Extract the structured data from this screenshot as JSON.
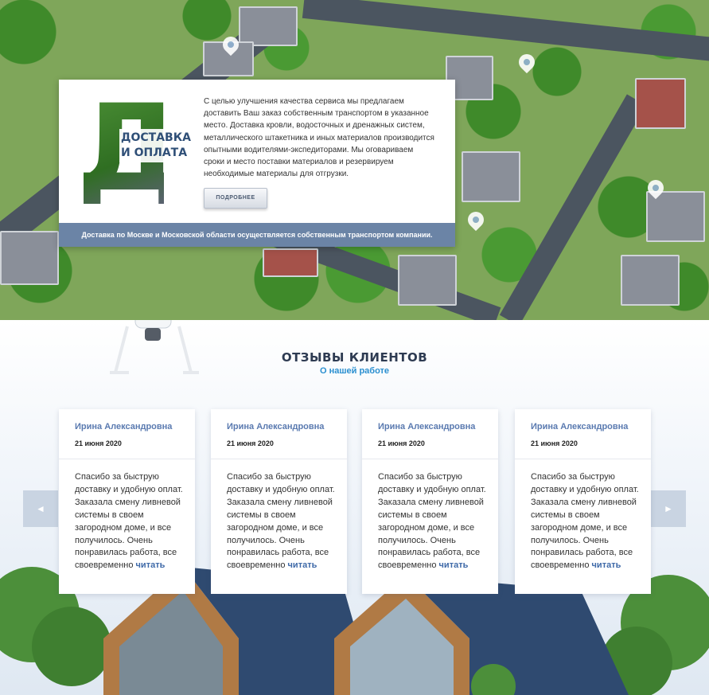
{
  "delivery": {
    "big_letter": "Д",
    "title_line1": "ДОСТАВКА",
    "title_line2": "И ОПЛАТА",
    "text": "С целью улучшения качества сервиса мы предлагаем доставить Ваш заказ собственным транспортом в указанное место. Доставка кровли, водосточных и дренажных систем, металлического штакетника и иных материалов производится опытными водителями-экспедиторами. Мы оговариваем сроки и место поставки материалов и резервируем необходимые материалы для отгрузки.",
    "more_button": "ПОДРОБНЕЕ",
    "footer": "Доставка по Москве и Московской области осуществляется собственным транспортом компании."
  },
  "reviews": {
    "title": "ОТЗЫВЫ КЛИЕНТОВ",
    "subtitle": "О нашей работе",
    "prev_arrow": "◄",
    "next_arrow": "►",
    "items": [
      {
        "name": "Ирина Александровна",
        "date": "21 июня 2020",
        "text": "Спасибо за быструю доставку и удобную оплат. Заказала смену ливневой системы в своем загородном доме, и все получилось. Очень понравилась работа, все своевременно",
        "link": "читать"
      },
      {
        "name": "Ирина Александровна",
        "date": "21 июня 2020",
        "text": "Спасибо за быструю доставку и удобную оплат. Заказала смену ливневой системы в своем загородном доме, и все получилось. Очень понравилась работа, все своевременно",
        "link": "читать"
      },
      {
        "name": "Ирина Александровна",
        "date": "21 июня 2020",
        "text": "Спасибо за быструю доставку и удобную оплат. Заказала смену ливневой системы в своем загородном доме, и все получилось. Очень понравилась работа, все своевременно",
        "link": "читать"
      },
      {
        "name": "Ирина Александровна",
        "date": "21 июня 2020",
        "text": "Спасибо за быструю доставку и удобную оплат. Заказала смену ливневой системы в своем загородном доме, и все получилось. Очень понравилась работа, все своевременно",
        "link": "читать"
      }
    ]
  },
  "colors": {
    "accent": "#6b84a6",
    "link": "#3f6aa8",
    "subtitle": "#2a8fd0",
    "title": "#2e3b52"
  }
}
